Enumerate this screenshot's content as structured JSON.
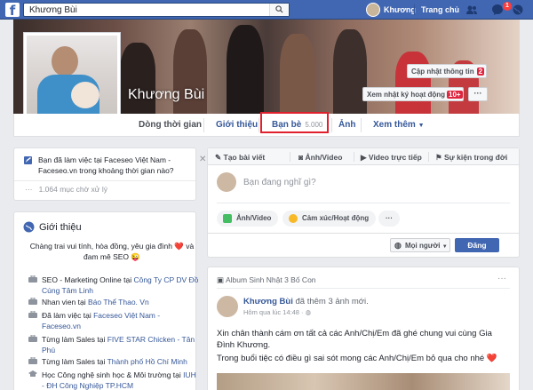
{
  "topbar": {
    "search_value": "Khương Bùi",
    "user_name": "Khương",
    "home_label": "Trang chủ",
    "notifications_badge": "1",
    "brand_color": "#4267b2"
  },
  "profile": {
    "name": "Khương Bùi",
    "update_info_label": "Cập nhật thông tin",
    "update_info_count": "2",
    "activity_log_label": "Xem nhật ký hoạt động",
    "activity_log_count": "10+",
    "more_label": "···"
  },
  "nav": {
    "timeline": "Dòng thời gian",
    "about": "Giới thiệu",
    "friends": "Bạn bè",
    "friends_count": "5.000",
    "photos": "Ảnh",
    "more": "Xem thêm"
  },
  "notice": {
    "text": "Bạn đã làm việc tại Faceseo Việt Nam - Faceseo.vn trong khoảng thời gian nào?",
    "close": "✕",
    "footer": "1.064 mục chờ xử lý"
  },
  "intro": {
    "title": "Giới thiệu",
    "desc": "Chàng trai vui tính, hòa đồng, yêu gia đình ❤️ và đam mê SEO 😜",
    "rows": [
      {
        "prefix": "SEO - Marketing Online tại ",
        "link": "Công Ty CP DV Đồ Cúng Tâm Linh"
      },
      {
        "prefix": "Nhan vien tại ",
        "link": "Báo Thể Thao. Vn"
      },
      {
        "prefix": "Đã làm việc tại ",
        "link": "Faceseo Việt Nam - Faceseo.vn"
      },
      {
        "prefix": "Từng làm Sales tại ",
        "link": "FIVE STAR Chicken - Tân Phú"
      },
      {
        "prefix": "Từng làm Sales tại ",
        "link": "Thành phố Hồ Chí Minh"
      },
      {
        "prefix": "Học Công nghệ sinh học & Môi trường tại ",
        "link": "IUH - ĐH Công Nghiệp TP.HCM"
      }
    ]
  },
  "composer": {
    "tabs": [
      "Tạo bài viết",
      "Ảnh/Video",
      "Video trực tiếp",
      "Sự kiện trong đời"
    ],
    "placeholder": "Bạn đang nghĩ gì?",
    "photo_video": "Ảnh/Video",
    "feeling": "Cảm xúc/Hoạt động",
    "more": "···",
    "audience": "Mọi người",
    "post": "Đăng"
  },
  "post": {
    "album": "Album Sinh Nhật 3 Bố Con",
    "more": "···",
    "author": "Khương Bùi",
    "action": " đã thêm 3 ảnh mới.",
    "time": "Hôm qua lúc 14:48 · ",
    "line1": "Xin chân thành cám ơn tất cả các Anh/Chị/Em đã ghé chung vui cùng Gia Đình Khương.",
    "line2": "Trong buổi tiệc có điều gì sai sót mong các Anh/Chị/Em bỏ qua cho nhé ❤️"
  }
}
